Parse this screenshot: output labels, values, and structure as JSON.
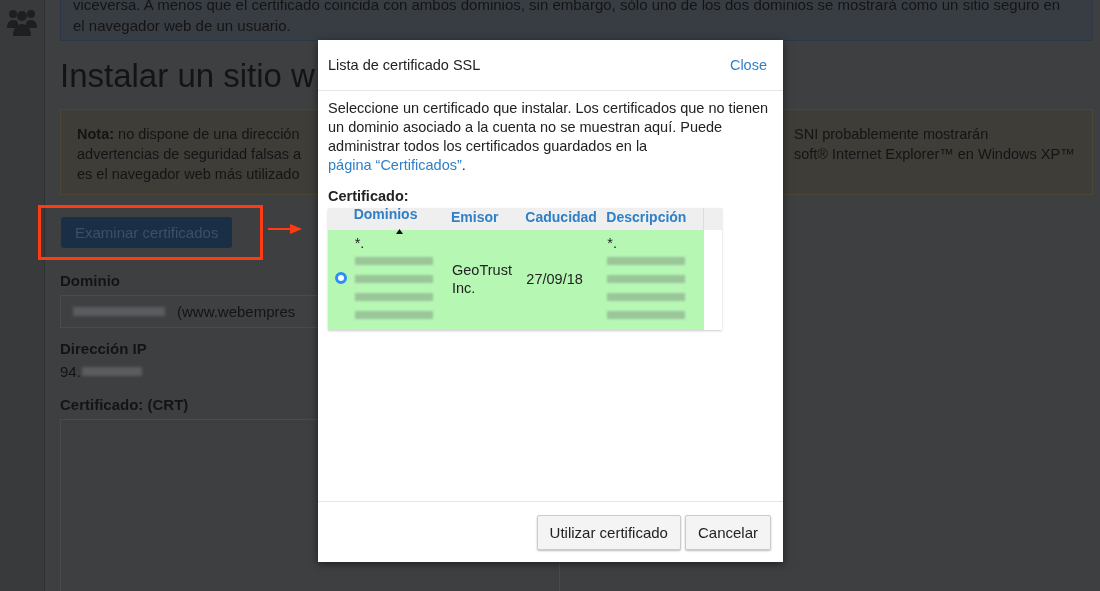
{
  "sidebar": {
    "items": [
      {
        "kind": "users"
      }
    ]
  },
  "page": {
    "info_lines": [
      "viceversa. A menos que el certificado coincida con ambos dominios, sin embargo, sólo uno de los dos dominios se mostrará como un sitio seguro en",
      "el navegador web de un usuario."
    ],
    "heading": "Instalar un sitio w",
    "note": {
      "lines": [
        {
          "left": "**Nota:** no dispone de una dirección",
          "right": "SNI probablemente mostrarán"
        },
        {
          "left": "advertencias de seguridad falsas a",
          "right": "soft® Internet Explorer™ en Windows XP™"
        },
        {
          "left": "es el navegador web más utilizado"
        }
      ]
    },
    "browse_button": {
      "label": "Examinar certificados",
      "highlighted": true
    },
    "domain": {
      "label": "Dominio",
      "value": "(www.webempres"
    },
    "ip": {
      "label": "Dirección IP",
      "value": "94."
    },
    "crt": {
      "label": "Certificado: (CRT)"
    }
  },
  "modal": {
    "title": "Lista de certificado SSL",
    "close": "Close",
    "intro": "Seleccione un certificado que instalar. Los certificados que no tienen un dominio asociado a la cuenta no se muestran aquí. Puede administrar todos los certificados guardados en la ",
    "intro_link": "página “Certificados”",
    "intro_end": ".",
    "table_label": "Certificado:",
    "columns": [
      {
        "label": "Dominios",
        "sorted": true
      },
      {
        "label": "Emisor",
        "sorted": false
      },
      {
        "label": "Caducidad",
        "sorted": false
      },
      {
        "label": "Descripción",
        "sorted": false
      }
    ],
    "rows": [
      {
        "selected": true,
        "cells": [
          [
            {
              "kind": "text",
              "text": "*."
            },
            {
              "kind": "blur"
            },
            {
              "kind": "blur"
            },
            {
              "kind": "blur"
            },
            {
              "kind": "blur"
            }
          ],
          [
            {
              "kind": "text",
              "text": "GeoTrust Inc."
            }
          ],
          [
            {
              "kind": "text",
              "text": "27/09/18"
            }
          ],
          [
            {
              "kind": "text",
              "text": "*."
            },
            {
              "kind": "blur"
            },
            {
              "kind": "blur"
            },
            {
              "kind": "blur"
            },
            {
              "kind": "blur"
            }
          ]
        ]
      }
    ],
    "buttons": [
      "Utilizar certificado",
      "Cancelar"
    ]
  }
}
